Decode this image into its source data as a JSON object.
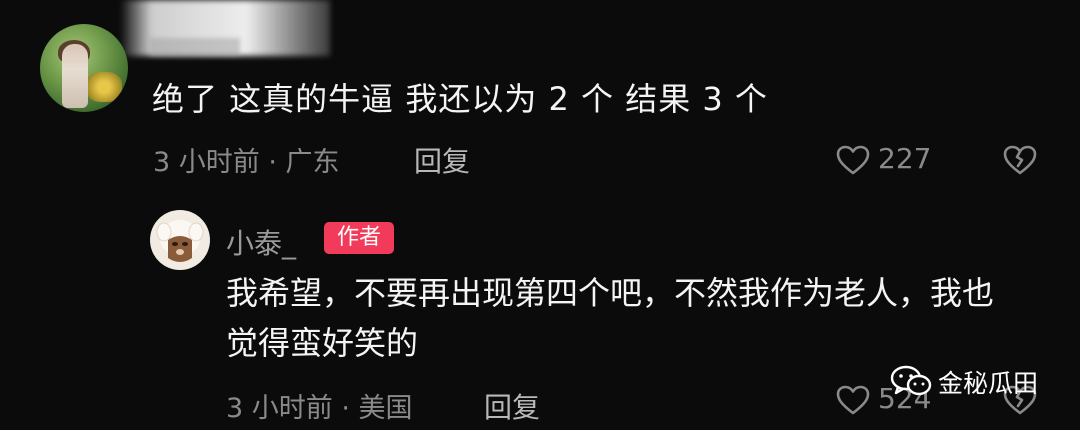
{
  "comment": {
    "text": "绝了 这真的牛逼 我还以为 2 个 结果 3 个",
    "meta": "3 小时前 · 广东",
    "reply_label": "回复",
    "like_count": "227"
  },
  "reply": {
    "username": "小泰_",
    "badge": "作者",
    "text": "我希望，不要再出现第四个吧，不然我作为老人，我也觉得蛮好笑的",
    "meta": "3 小时前 · 美国",
    "reply_label": "回复",
    "like_count": "524"
  },
  "watermark": {
    "text": "金秘瓜田"
  },
  "colors": {
    "background": "#0b0b0b",
    "badge": "#f23a5a",
    "muted": "#8a8a8a"
  }
}
